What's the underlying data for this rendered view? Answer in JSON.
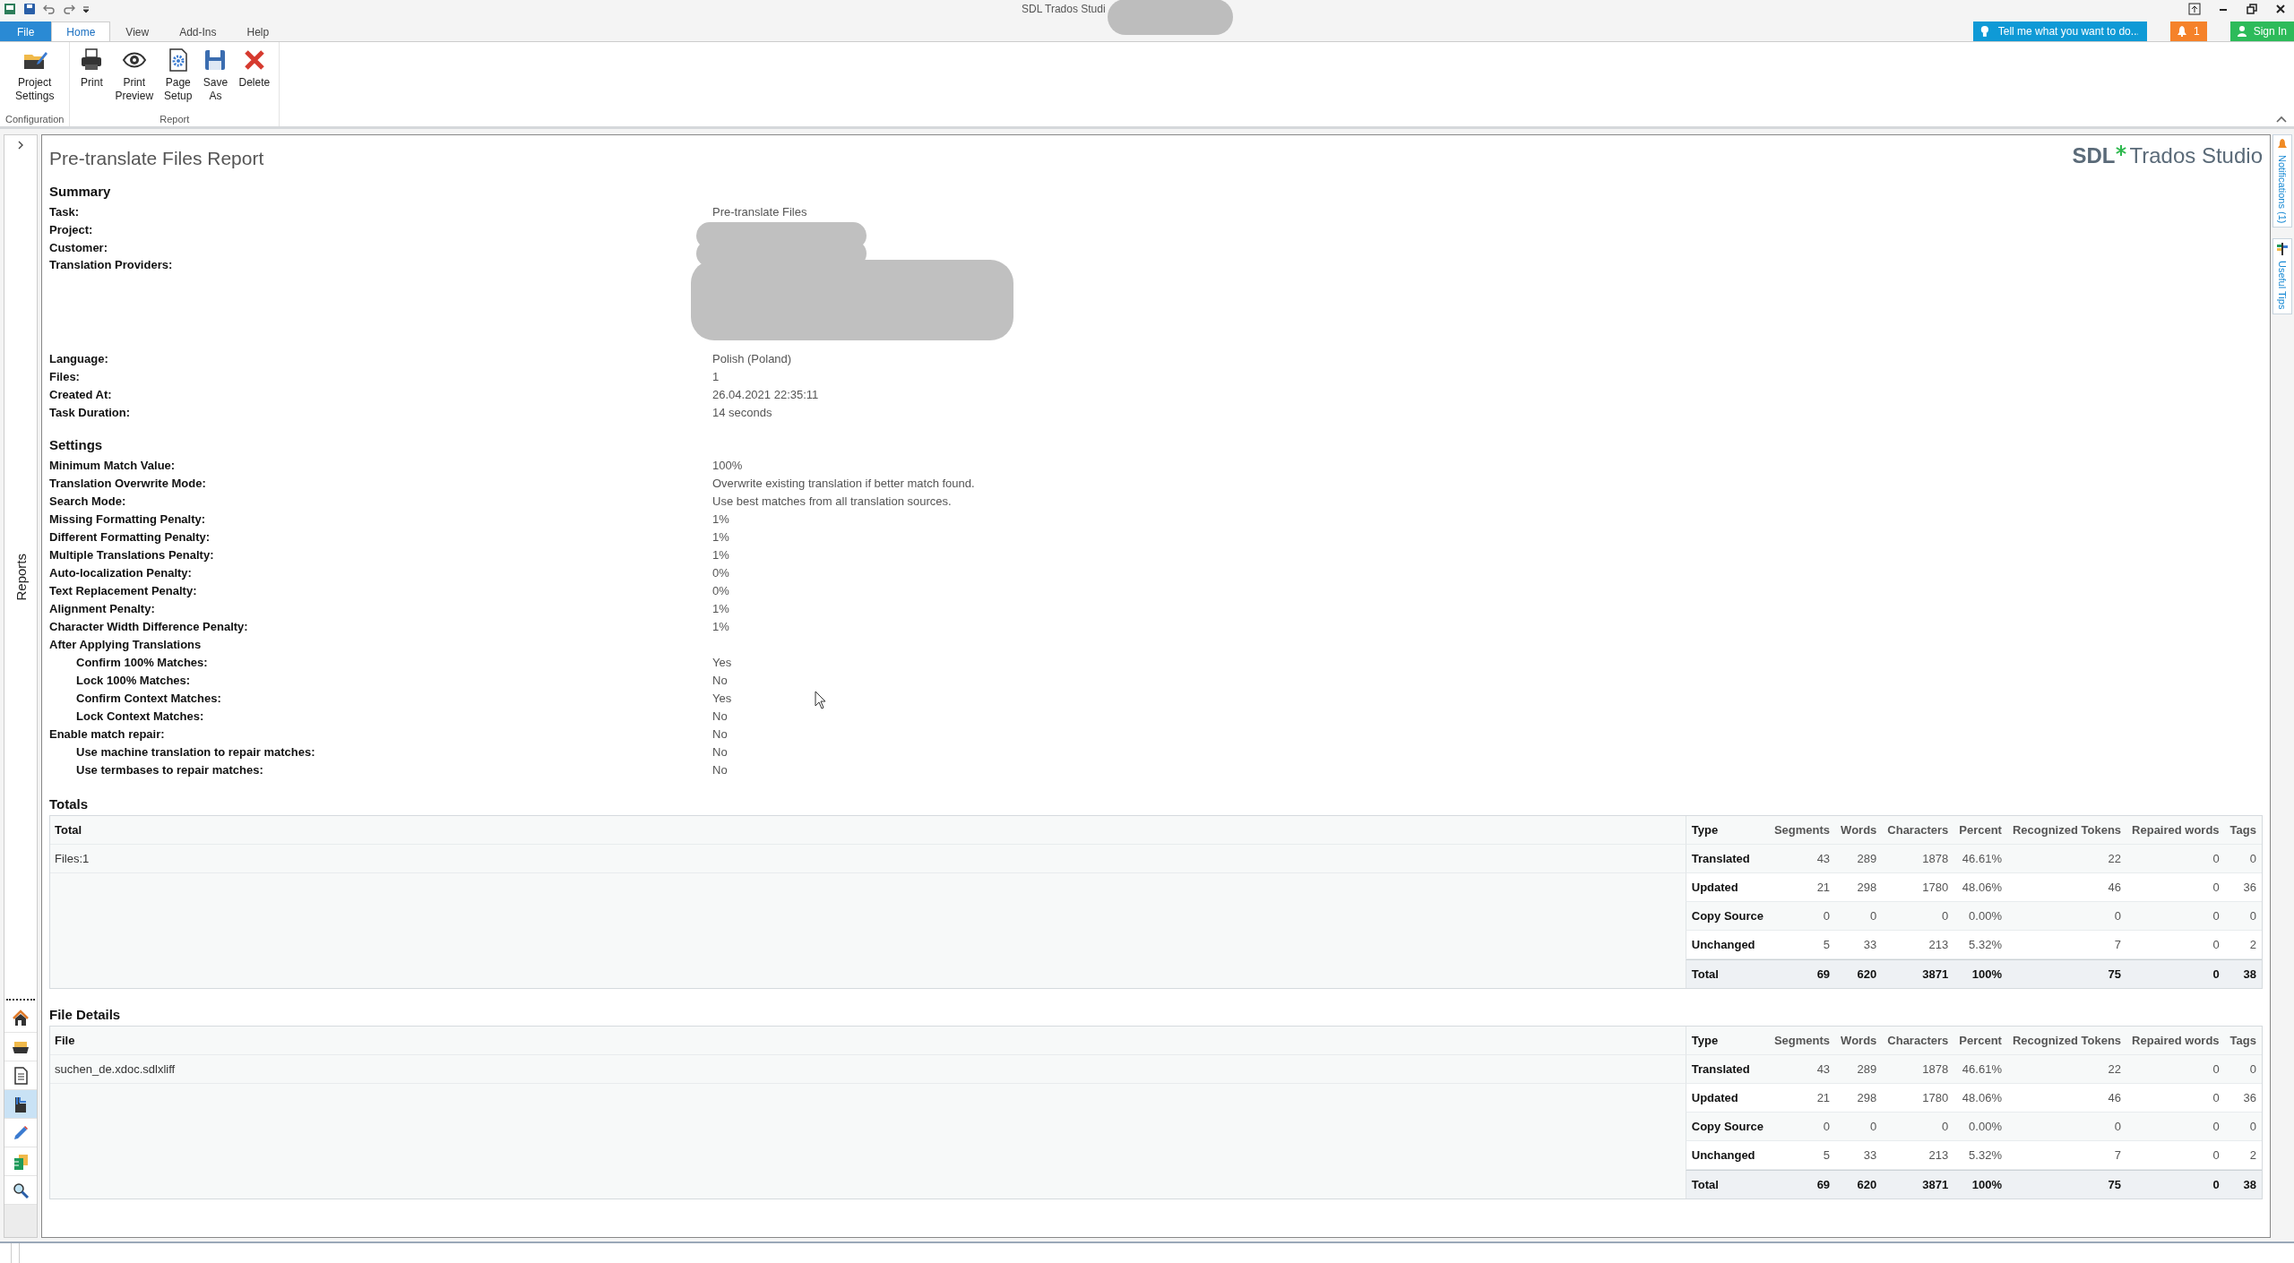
{
  "window": {
    "title": "SDL Trados Studi"
  },
  "menu_tabs": [
    {
      "label": "File",
      "kind": "file",
      "selected": false
    },
    {
      "label": "Home",
      "kind": "tab",
      "selected": true
    },
    {
      "label": "View",
      "kind": "tab",
      "selected": false
    },
    {
      "label": "Add-Ins",
      "kind": "tab",
      "selected": false
    },
    {
      "label": "Help",
      "kind": "tab",
      "selected": false
    }
  ],
  "tell_me": {
    "placeholder": "Tell me what you want to do..."
  },
  "notifications_badge": "1",
  "sign_in": "Sign In",
  "ribbon": [
    {
      "label": "Configuration",
      "buttons": [
        {
          "label": "Project Settings",
          "kind": "settings"
        }
      ]
    },
    {
      "label": "Report",
      "buttons": [
        {
          "label": "Print",
          "kind": "print"
        },
        {
          "label": "Print Preview",
          "kind": "preview"
        },
        {
          "label": "Page Setup",
          "kind": "setup"
        },
        {
          "label": "Save As",
          "kind": "save"
        },
        {
          "label": "Delete",
          "kind": "delete"
        }
      ]
    }
  ],
  "sidebar": {
    "title": "Reports",
    "items": [
      {
        "kind": "home",
        "selected": false
      },
      {
        "kind": "projects",
        "selected": false
      },
      {
        "kind": "files",
        "selected": false
      },
      {
        "kind": "reports",
        "selected": true
      },
      {
        "kind": "editor",
        "selected": false
      },
      {
        "kind": "termbases",
        "selected": false
      },
      {
        "kind": "search",
        "selected": false
      }
    ]
  },
  "side_tabs": [
    "Notifications (1)",
    "Useful Tips"
  ],
  "report": {
    "title": "Pre-translate Files Report",
    "logo": {
      "brand": "SDL",
      "product": "Trados Studio"
    },
    "summary": {
      "heading": "Summary",
      "rows": [
        {
          "label": "Task:",
          "value": "Pre-translate Files"
        },
        {
          "label": "Project:",
          "redacted": true
        },
        {
          "label": "Customer:",
          "redacted": true
        },
        {
          "label": "Translation Providers:",
          "redacted": true
        },
        {
          "label": "Language:",
          "value": "Polish (Poland)"
        },
        {
          "label": "Files:",
          "value": "1"
        },
        {
          "label": "Created At:",
          "value": "26.04.2021 22:35:11"
        },
        {
          "label": "Task Duration:",
          "value": "14 seconds"
        }
      ]
    },
    "settings": {
      "heading": "Settings",
      "rows": [
        {
          "label": "Minimum Match Value:",
          "value": "100%"
        },
        {
          "label": "Translation Overwrite Mode:",
          "value": "Overwrite existing translation if better match found."
        },
        {
          "label": "Search Mode:",
          "value": "Use best matches from all translation sources."
        },
        {
          "label": "Missing Formatting Penalty:",
          "value": "1%"
        },
        {
          "label": "Different Formatting Penalty:",
          "value": "1%"
        },
        {
          "label": "Multiple Translations Penalty:",
          "value": "1%"
        },
        {
          "label": "Auto-localization Penalty:",
          "value": "0%"
        },
        {
          "label": "Text Replacement Penalty:",
          "value": "0%"
        },
        {
          "label": "Alignment Penalty:",
          "value": "1%"
        },
        {
          "label": "Character Width Difference Penalty:",
          "value": "1%"
        },
        {
          "label": "After Applying Translations",
          "children": [
            {
              "label": "Confirm 100% Matches:",
              "value": "Yes"
            },
            {
              "label": "Lock 100% Matches:",
              "value": "No"
            },
            {
              "label": "Confirm Context Matches:",
              "value": "Yes"
            },
            {
              "label": "Lock Context Matches:",
              "value": "No"
            }
          ]
        },
        {
          "label": "Enable match repair:",
          "value": "No",
          "children": [
            {
              "label": "Use machine translation to repair matches:",
              "value": "No"
            },
            {
              "label": "Use termbases to repair matches:",
              "value": "No"
            }
          ]
        }
      ]
    },
    "tables": [
      {
        "heading": "Totals",
        "first_column": "Total",
        "first_cell": "Files:1",
        "columns": [
          "Type",
          "Segments",
          "Words",
          "Characters",
          "Percent",
          "Recognized Tokens",
          "Repaired words",
          "Tags"
        ],
        "rows": [
          [
            "Translated",
            "43",
            "289",
            "1878",
            "46.61%",
            "22",
            "0",
            "0"
          ],
          [
            "Updated",
            "21",
            "298",
            "1780",
            "48.06%",
            "46",
            "0",
            "36"
          ],
          [
            "Copy Source",
            "0",
            "0",
            "0",
            "0.00%",
            "0",
            "0",
            "0"
          ],
          [
            "Unchanged",
            "5",
            "33",
            "213",
            "5.32%",
            "7",
            "0",
            "2"
          ]
        ],
        "total": [
          "Total",
          "69",
          "620",
          "3871",
          "100%",
          "75",
          "0",
          "38"
        ]
      },
      {
        "heading": "File Details",
        "first_column": "File",
        "first_cell": "suchen_de.xdoc.sdlxliff",
        "columns": [
          "Type",
          "Segments",
          "Words",
          "Characters",
          "Percent",
          "Recognized Tokens",
          "Repaired words",
          "Tags"
        ],
        "rows": [
          [
            "Translated",
            "43",
            "289",
            "1878",
            "46.61%",
            "22",
            "0",
            "0"
          ],
          [
            "Updated",
            "21",
            "298",
            "1780",
            "48.06%",
            "46",
            "0",
            "36"
          ],
          [
            "Copy Source",
            "0",
            "0",
            "0",
            "0.00%",
            "0",
            "0",
            "0"
          ],
          [
            "Unchanged",
            "5",
            "33",
            "213",
            "5.32%",
            "7",
            "0",
            "2"
          ]
        ],
        "total": [
          "Total",
          "69",
          "620",
          "3871",
          "100%",
          "75",
          "0",
          "38"
        ]
      }
    ]
  }
}
